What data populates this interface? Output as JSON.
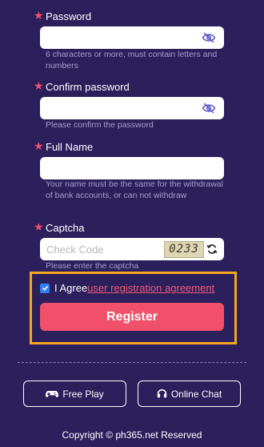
{
  "password": {
    "label": "Password",
    "placeholder": "",
    "hint": "6 characters or more, must contain letters and numbers"
  },
  "confirm_password": {
    "label": "Confirm password",
    "placeholder": "",
    "hint": "Please confirm the password"
  },
  "full_name": {
    "label": "Full Name",
    "placeholder": "",
    "hint": "Your name must be the same for the withdrawal of bank accounts, or can not withdraw"
  },
  "captcha": {
    "label": "Captcha",
    "placeholder": "Check Code",
    "code": "0233",
    "hint": "Please enter the captcha"
  },
  "agreement": {
    "prefix": "I Agree",
    "link": "user registration agreement",
    "checked": true
  },
  "register_label": "Register",
  "footer": {
    "free_play": "Free Play",
    "online_chat": "Online Chat",
    "copyright": "Copyright © ph365.net Reserved"
  },
  "colors": {
    "background": "#2b1f5c",
    "accent": "#f0506a",
    "highlight": "#f5a623",
    "hint": "#a79fcf"
  },
  "icons": {
    "password_toggle": "eye-off-icon",
    "captcha_refresh": "refresh-icon",
    "free_play": "gamepad-icon",
    "online_chat": "headset-icon",
    "required": "star-icon"
  }
}
